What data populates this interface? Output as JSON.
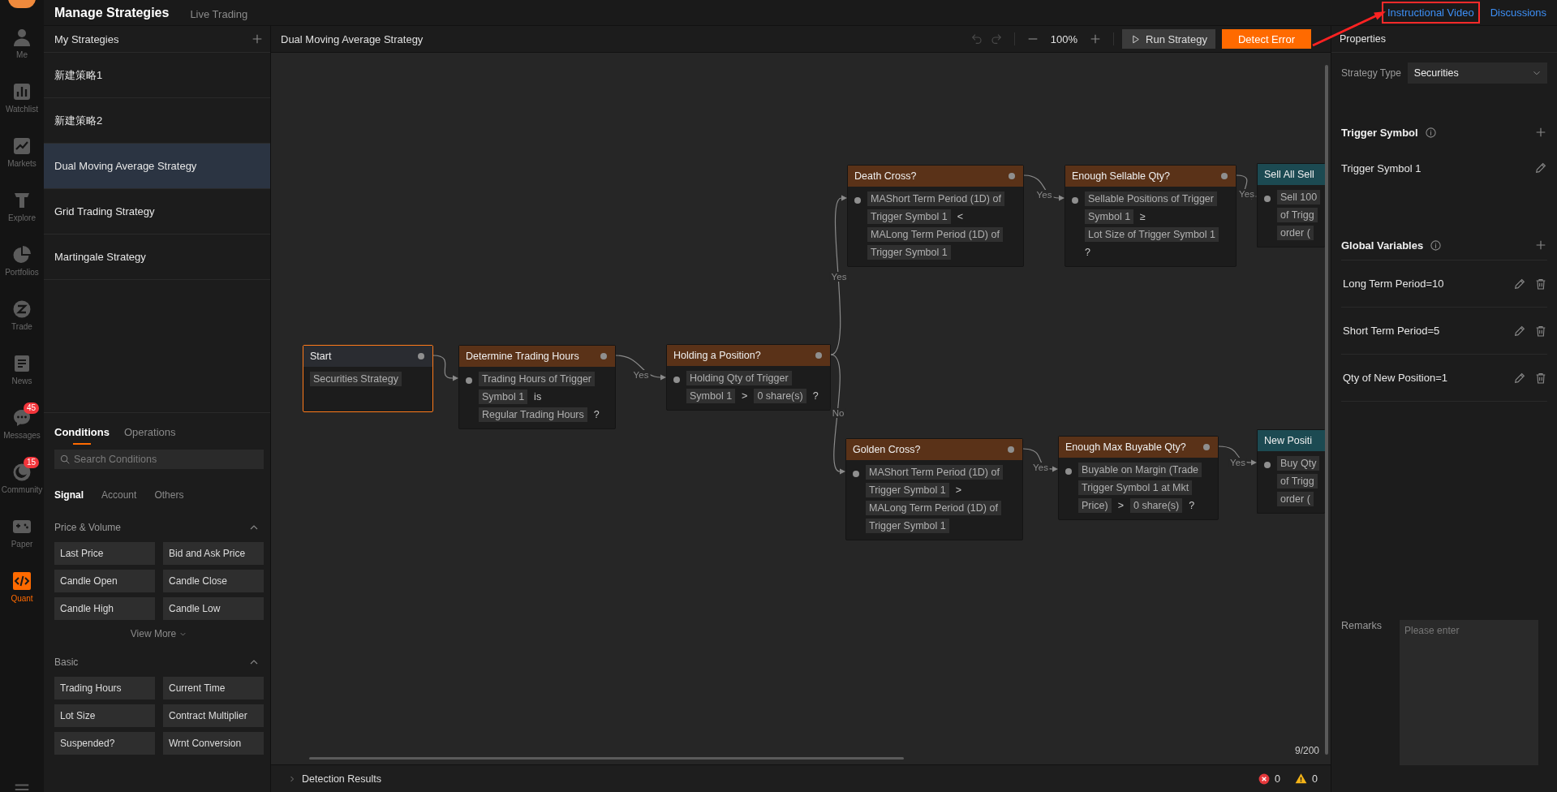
{
  "top_bar": {
    "tabs": [
      {
        "label": "Manage Strategies",
        "selected": true
      },
      {
        "label": "Live Trading",
        "selected": false
      }
    ],
    "links": [
      {
        "label": "Instructional Video",
        "highlighted": true
      },
      {
        "label": "Discussions",
        "highlighted": false
      }
    ]
  },
  "nav_rail": {
    "items": [
      {
        "kind": "person",
        "label": "Me",
        "selected": false
      },
      {
        "kind": "watchlist",
        "label": "Watchlist",
        "selected": false
      },
      {
        "kind": "markets",
        "label": "Markets",
        "selected": false
      },
      {
        "kind": "explore",
        "label": "Explore",
        "selected": false
      },
      {
        "kind": "portfolios",
        "label": "Portfolios",
        "selected": false
      },
      {
        "kind": "trade",
        "label": "Trade",
        "selected": false
      },
      {
        "kind": "news",
        "label": "News",
        "selected": false
      },
      {
        "kind": "messages",
        "label": "Messages",
        "selected": false,
        "badge": "45"
      },
      {
        "kind": "community",
        "label": "Community",
        "selected": false,
        "badge": "15"
      },
      {
        "kind": "paper",
        "label": "Paper",
        "selected": false
      },
      {
        "kind": "quant",
        "label": "Quant",
        "selected": true
      }
    ]
  },
  "strategies": {
    "title": "My Strategies",
    "items": [
      {
        "label": "新建策略1",
        "selected": false
      },
      {
        "label": "新建策略2",
        "selected": false
      },
      {
        "label": "Dual Moving Average Strategy",
        "selected": true
      },
      {
        "label": "Grid Trading Strategy",
        "selected": false
      },
      {
        "label": "Martingale Strategy",
        "selected": false
      }
    ]
  },
  "conditions": {
    "tabs": [
      {
        "label": "Conditions",
        "selected": true
      },
      {
        "label": "Operations",
        "selected": false
      }
    ],
    "search": {
      "placeholder": "Search Conditions"
    },
    "subtabs": [
      {
        "label": "Signal",
        "selected": true
      },
      {
        "label": "Account",
        "selected": false
      },
      {
        "label": "Others",
        "selected": false
      }
    ],
    "sections": [
      {
        "title": "Price & Volume",
        "expanded": true,
        "items": [
          "Last Price",
          "Bid and Ask Price",
          "Candle Open",
          "Candle Close",
          "Candle High",
          "Candle Low"
        ],
        "more": "View More"
      },
      {
        "title": "Basic",
        "expanded": true,
        "items": [
          "Trading Hours",
          "Current Time",
          "Lot Size",
          "Contract Multiplier",
          "Suspended?",
          "Wrnt Conversion"
        ]
      }
    ]
  },
  "editor": {
    "title": "Dual Moving Average Strategy",
    "undo": {
      "disabled": true
    },
    "redo": {
      "disabled": true
    },
    "zoom": "100%",
    "buttons": [
      {
        "kind": "run",
        "label": "Run Strategy"
      },
      {
        "kind": "detect",
        "label": "Detect Error"
      }
    ],
    "flow": {
      "kind": "start",
      "title": "Start",
      "selected": true,
      "lines": [
        [
          {
            "kind": "chip",
            "text": "Securities Strategy"
          }
        ]
      ],
      "next": [
        {
          "node": {
            "kind": "condition",
            "title": "Determine Trading Hours",
            "selected": false,
            "lines": [
              [
                {
                  "kind": "chip",
                  "text": "Trading Hours of Trigger"
                }
              ],
              [
                {
                  "kind": "chip",
                  "text": "Symbol 1"
                },
                {
                  "kind": "op",
                  "text": "is"
                }
              ],
              [
                {
                  "kind": "chip",
                  "text": "Regular Trading Hours"
                },
                {
                  "kind": "op",
                  "text": "?"
                }
              ]
            ],
            "next": [
              {
                "label": "Yes",
                "node": {
                  "kind": "condition",
                  "title": "Holding a Position?",
                  "selected": false,
                  "lines": [
                    [
                      {
                        "kind": "chip",
                        "text": "Holding Qty of Trigger"
                      }
                    ],
                    [
                      {
                        "kind": "chip",
                        "text": "Symbol 1"
                      },
                      {
                        "kind": "op",
                        "text": ">"
                      },
                      {
                        "kind": "chip",
                        "text": "0 share(s)"
                      },
                      {
                        "kind": "op",
                        "text": "?"
                      }
                    ]
                  ],
                  "next": [
                    {
                      "label": "Yes",
                      "node": {
                        "kind": "condition",
                        "title": "Death Cross?",
                        "selected": false,
                        "lines": [
                          [
                            {
                              "kind": "chip",
                              "text": "MAShort Term Period (1D) of"
                            }
                          ],
                          [
                            {
                              "kind": "chip",
                              "text": "Trigger Symbol 1"
                            },
                            {
                              "kind": "op",
                              "text": "<"
                            }
                          ],
                          [
                            {
                              "kind": "chip",
                              "text": "MALong Term Period (1D) of"
                            }
                          ],
                          [
                            {
                              "kind": "chip",
                              "text": "Trigger Symbol 1"
                            }
                          ]
                        ],
                        "next": [
                          {
                            "label": "Yes",
                            "node": {
                              "kind": "condition",
                              "title": "Enough Sellable Qty?",
                              "selected": false,
                              "lines": [
                                [
                                  {
                                    "kind": "chip",
                                    "text": "Sellable Positions of Trigger"
                                  }
                                ],
                                [
                                  {
                                    "kind": "chip",
                                    "text": "Symbol 1"
                                  },
                                  {
                                    "kind": "op",
                                    "text": "≥"
                                  }
                                ],
                                [
                                  {
                                    "kind": "chip",
                                    "text": "Lot Size of Trigger Symbol 1"
                                  }
                                ],
                                [
                                  {
                                    "kind": "op",
                                    "text": "?"
                                  }
                                ]
                              ],
                              "next": [
                                {
                                  "label": "Yes",
                                  "node": {
                                    "kind": "action",
                                    "title": "Sell All Sell",
                                    "selected": false,
                                    "lines": [
                                      [
                                        {
                                          "kind": "chip",
                                          "text": "Sell 100"
                                        }
                                      ],
                                      [
                                        {
                                          "kind": "chip",
                                          "text": "of Trigg"
                                        }
                                      ],
                                      [
                                        {
                                          "kind": "chip",
                                          "text": "order ("
                                        }
                                      ]
                                    ]
                                  }
                                }
                              ]
                            }
                          }
                        ]
                      }
                    },
                    {
                      "label": "No",
                      "node": {
                        "kind": "condition",
                        "title": "Golden Cross?",
                        "selected": false,
                        "lines": [
                          [
                            {
                              "kind": "chip",
                              "text": "MAShort Term Period (1D) of"
                            }
                          ],
                          [
                            {
                              "kind": "chip",
                              "text": "Trigger Symbol 1"
                            },
                            {
                              "kind": "op",
                              "text": ">"
                            }
                          ],
                          [
                            {
                              "kind": "chip",
                              "text": "MALong Term Period (1D) of"
                            }
                          ],
                          [
                            {
                              "kind": "chip",
                              "text": "Trigger Symbol 1"
                            }
                          ]
                        ],
                        "next": [
                          {
                            "label": "Yes",
                            "node": {
                              "kind": "condition",
                              "title": "Enough Max Buyable Qty?",
                              "selected": false,
                              "lines": [
                                [
                                  {
                                    "kind": "chip",
                                    "text": "Buyable on Margin (Trade"
                                  }
                                ],
                                [
                                  {
                                    "kind": "chip",
                                    "text": "Trigger Symbol 1 at Mkt"
                                  }
                                ],
                                [
                                  {
                                    "kind": "chip",
                                    "text": "Price)"
                                  },
                                  {
                                    "kind": "op",
                                    "text": ">"
                                  },
                                  {
                                    "kind": "chip",
                                    "text": "0 share(s)"
                                  },
                                  {
                                    "kind": "op",
                                    "text": "?"
                                  }
                                ]
                              ],
                              "next": [
                                {
                                  "label": "Yes",
                                  "node": {
                                    "kind": "action",
                                    "title": "New Positi",
                                    "selected": false,
                                    "lines": [
                                      [
                                        {
                                          "kind": "chip",
                                          "text": "Buy Qty"
                                        }
                                      ],
                                      [
                                        {
                                          "kind": "chip",
                                          "text": "of Trigg"
                                        }
                                      ],
                                      [
                                        {
                                          "kind": "chip",
                                          "text": "order ("
                                        }
                                      ]
                                    ]
                                  }
                                }
                              ]
                            }
                          }
                        ]
                      }
                    }
                  ]
                }
              }
            ]
          }
        }
      ]
    },
    "node_count": "9/200",
    "detection": {
      "label": "Detection Results",
      "errors": "0",
      "warnings": "0"
    }
  },
  "properties": {
    "title": "Properties",
    "strategy_type": {
      "label": "Strategy Type",
      "value": "Securities"
    },
    "trigger_symbol": {
      "title": "Trigger Symbol",
      "items": [
        "Trigger Symbol 1"
      ]
    },
    "global_variables": {
      "title": "Global Variables",
      "items": [
        "Long Term Period=10",
        "Short Term Period=5",
        "Qty of New Position=1"
      ]
    },
    "remarks": {
      "label": "Remarks",
      "placeholder": "Please enter"
    }
  }
}
